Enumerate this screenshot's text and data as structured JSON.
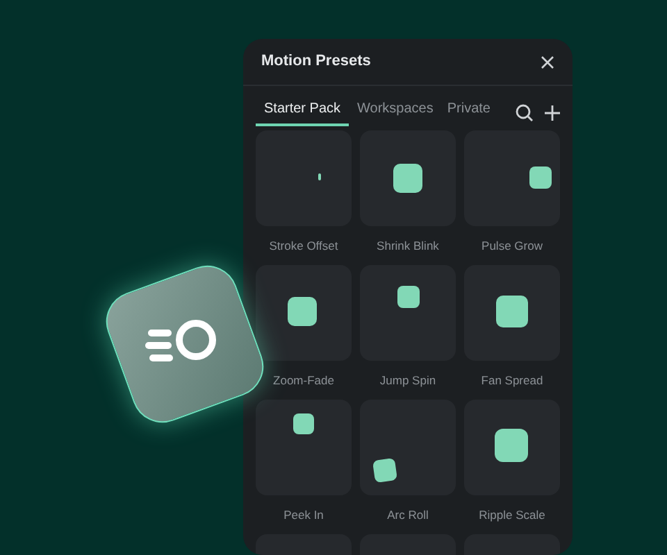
{
  "panel": {
    "title": "Motion Presets"
  },
  "tabs": [
    {
      "label": "Starter Pack",
      "selected": true
    },
    {
      "label": "Workspaces",
      "selected": false
    },
    {
      "label": "Private",
      "selected": false
    }
  ],
  "presets": [
    {
      "name": "Stroke Offset"
    },
    {
      "name": "Shrink Blink"
    },
    {
      "name": "Pulse Grow"
    },
    {
      "name": "Zoom-Fade"
    },
    {
      "name": "Jump Spin"
    },
    {
      "name": "Fan Spread"
    },
    {
      "name": "Peek In"
    },
    {
      "name": "Arc Roll"
    },
    {
      "name": "Ripple Scale"
    }
  ]
}
